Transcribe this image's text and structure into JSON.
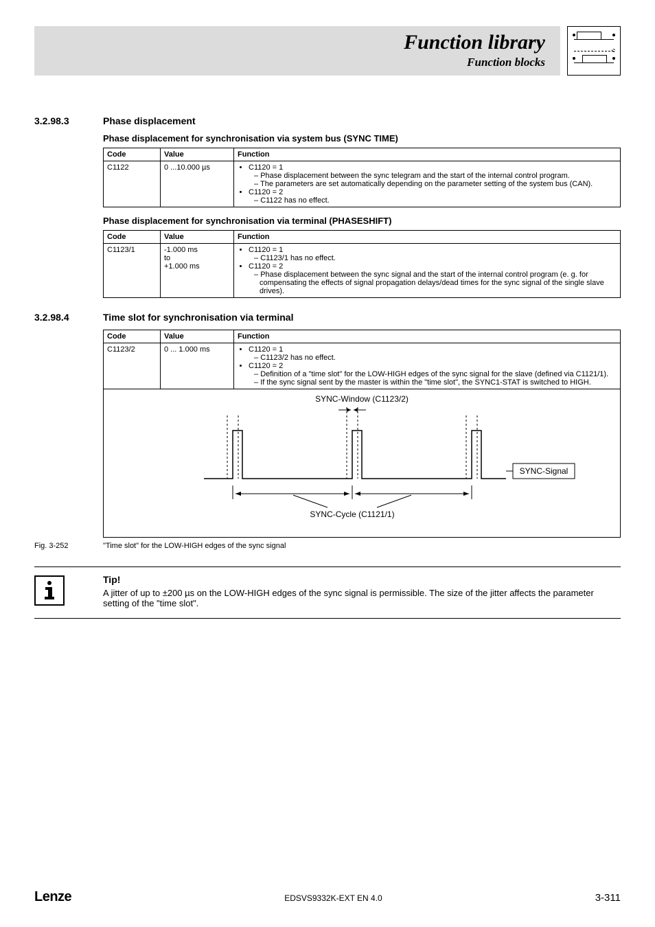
{
  "header": {
    "title": "Function library",
    "subtitle": "Function blocks"
  },
  "section1": {
    "num": "3.2.98.3",
    "title": "Phase displacement",
    "sub1": "Phase displacement for synchronisation via system bus (SYNC TIME)",
    "sub2": "Phase displacement for synchronisation via terminal (PHASESHIFT)",
    "th_code": "Code",
    "th_value": "Value",
    "th_func": "Function",
    "t1": {
      "code": "C1122",
      "value": "0 ...10.000 µs",
      "b1": "C1120 = 1",
      "b1a": "Phase displacement between the sync telegram and the start of the internal control program.",
      "b1b": "The parameters are set automatically depending on the parameter setting of the system bus (CAN).",
      "b2": "C1120 = 2",
      "b2a": "C1122 has no effect."
    },
    "t2": {
      "code": "C1123/1",
      "value_l1": "-1.000 ms",
      "value_l2": "to",
      "value_l3": "+1.000 ms",
      "b1": "C1120 = 1",
      "b1a": "C1123/1 has no effect.",
      "b2": "C1120 = 2",
      "b2a": "Phase displacement between the sync signal and the start of the internal control program (e. g. for compensating the effects of signal propagation delays/dead times for the sync signal of the single slave drives)."
    }
  },
  "section2": {
    "num": "3.2.98.4",
    "title": "Time slot for synchronisation via terminal",
    "th_code": "Code",
    "th_value": "Value",
    "th_func": "Function",
    "t1": {
      "code": "C1123/2",
      "value": "0 ... 1.000 ms",
      "b1": "C1120 = 1",
      "b1a": "C1123/2 has no effect.",
      "b2": "C1120 = 2",
      "b2a": "Definition of a \"time slot\" for the LOW-HIGH edges of the sync signal for the slave (defined via C1121/1).",
      "b2b": "If the sync signal sent by the master is within the \"time slot\", the SYNC1-STAT is switched to HIGH."
    }
  },
  "figure": {
    "window_label": "SYNC-Window (C1123/2)",
    "signal_label": "SYNC-Signal",
    "cycle_label": "SYNC-Cycle (C1121/1)",
    "num": "Fig. 3-252",
    "caption": "\"Time slot\" for the LOW-HIGH edges of the sync signal"
  },
  "tip": {
    "title": "Tip!",
    "body": "A jitter of up to ±200 µs on the LOW-HIGH edges of the sync signal is permissible. The size of the jitter affects the parameter setting of the \"time slot\"."
  },
  "footer": {
    "brand": "Lenze",
    "doc": "EDSVS9332K-EXT EN 4.0",
    "page": "3-311"
  }
}
